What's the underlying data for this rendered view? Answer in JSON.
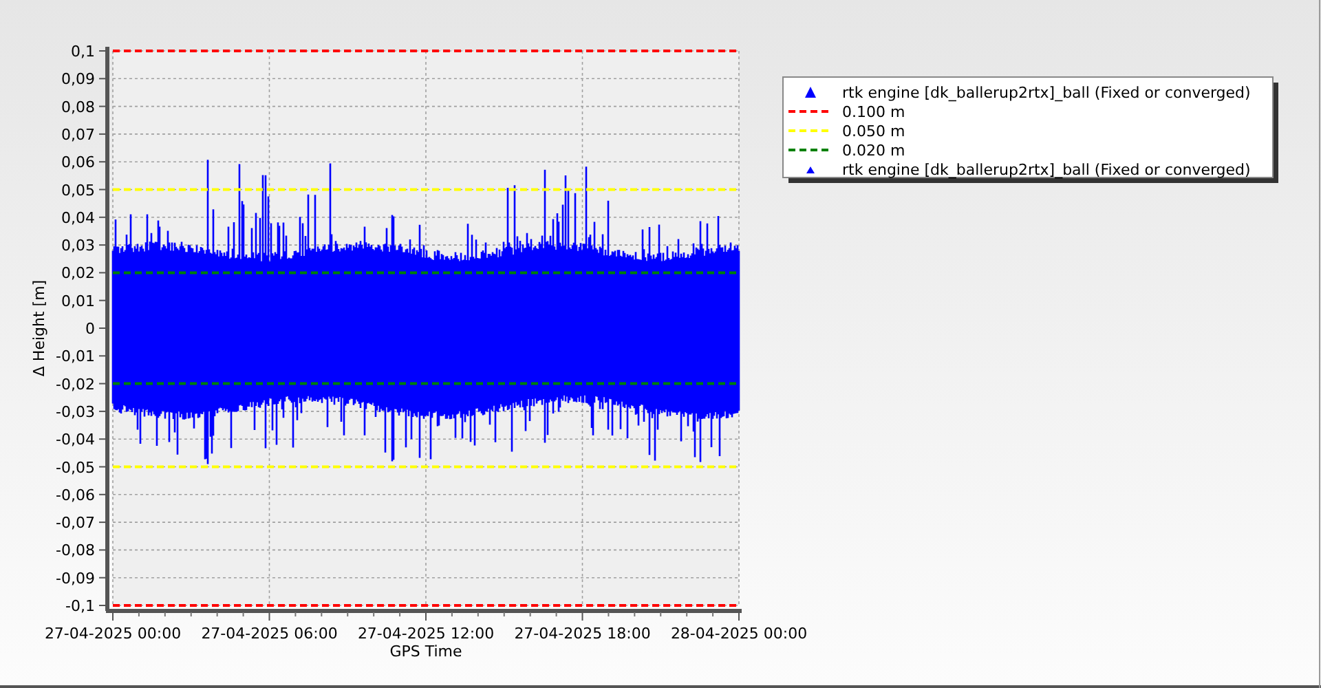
{
  "chart_data": {
    "type": "line",
    "xlabel": "GPS Time",
    "ylabel": "Δ Height [m]",
    "grid": true,
    "categories": [
      "27-04-2025 00:00",
      "27-04-2025 06:00",
      "27-04-2025 12:00",
      "27-04-2025 18:00",
      "28-04-2025 00:00"
    ],
    "ylim": [
      -0.1,
      0.1
    ],
    "yticks": [
      {
        "value": 0.1,
        "label": "0,1"
      },
      {
        "value": 0.09,
        "label": "0,09"
      },
      {
        "value": 0.08,
        "label": "0,08"
      },
      {
        "value": 0.07,
        "label": "0,07"
      },
      {
        "value": 0.06,
        "label": "0,06"
      },
      {
        "value": 0.05,
        "label": "0,05"
      },
      {
        "value": 0.04,
        "label": "0,04"
      },
      {
        "value": 0.03,
        "label": "0,03"
      },
      {
        "value": 0.02,
        "label": "0,02"
      },
      {
        "value": 0.01,
        "label": "0,01"
      },
      {
        "value": 0,
        "label": "0"
      },
      {
        "value": -0.01,
        "label": "-0,01"
      },
      {
        "value": -0.02,
        "label": "-0,02"
      },
      {
        "value": -0.03,
        "label": "-0,03"
      },
      {
        "value": -0.04,
        "label": "-0,04"
      },
      {
        "value": -0.05,
        "label": "-0,05"
      },
      {
        "value": -0.06,
        "label": "-0,06"
      },
      {
        "value": -0.07,
        "label": "-0,07"
      },
      {
        "value": -0.08,
        "label": "-0,08"
      },
      {
        "value": -0.09,
        "label": "-0,09"
      },
      {
        "value": -0.1,
        "label": "-0,1"
      }
    ],
    "series": [
      {
        "name": "0.100 m",
        "color": "#ff0000",
        "line_style": "dashed",
        "values": [
          0.1,
          0.1,
          0.1,
          0.1,
          0.1
        ]
      },
      {
        "color": "#ff0000",
        "line_style": "dashed",
        "values": [
          -0.1,
          -0.1,
          -0.1,
          -0.1,
          -0.1
        ]
      },
      {
        "name": "0.050 m",
        "color": "#ffff00",
        "line_style": "dashed",
        "values": [
          0.05,
          0.05,
          0.05,
          0.05,
          0.05
        ]
      },
      {
        "color": "#ffff00",
        "line_style": "dashed",
        "values": [
          -0.05,
          -0.05,
          -0.05,
          -0.05,
          -0.05
        ]
      },
      {
        "name": "0.020 m",
        "color": "#008000",
        "line_style": "dashed",
        "values": [
          0.02,
          0.02,
          0.02,
          0.02,
          0.02
        ]
      },
      {
        "color": "#008000",
        "line_style": "dashed",
        "values": [
          -0.02,
          -0.02,
          -0.02,
          -0.02,
          -0.02
        ]
      }
    ],
    "legend": {
      "items": [
        {
          "kind": "marker",
          "label": "rtk engine [dk_ballerup2rtx]_ball (Fixed or converged)",
          "color": "#0000ff"
        },
        {
          "kind": "series"
        },
        {
          "kind": "series"
        },
        {
          "kind": "series"
        },
        {
          "kind": "small-marker",
          "label": "rtk engine [dk_ballerup2rtx]_ball (Fixed or converged)",
          "color": "#0000ff"
        }
      ]
    }
  }
}
